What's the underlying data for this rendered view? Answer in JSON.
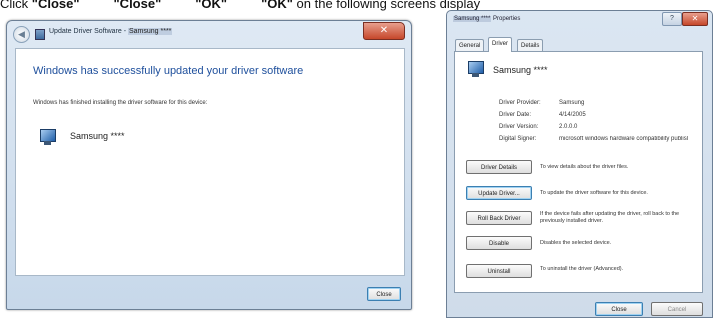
{
  "caption": {
    "prefix": "Click ",
    "word1": "\"Close\"",
    "word2": "\"Close\"",
    "word3": "\"OK\"",
    "word4": "\"OK\"",
    "suffix": "on the following screens display"
  },
  "left_window": {
    "title_prefix": "Update Driver Software - ",
    "title_brand": "Samsung ****",
    "close_glyph": "✕",
    "heading": "Windows has successfully updated your driver software",
    "subtext": "Windows has finished installing the driver software for this device:",
    "device_name": "Samsung ****",
    "close_button": "Close"
  },
  "right_window": {
    "title_brand": "Samsung ****",
    "title_suffix": " Properties",
    "help_glyph": "?",
    "close_glyph": "✕",
    "tabs": [
      {
        "label": "General",
        "active": false
      },
      {
        "label": "Driver",
        "active": true
      },
      {
        "label": "Details",
        "active": false
      }
    ],
    "device_name": "Samsung ****",
    "properties": [
      {
        "label": "Driver Provider:",
        "value": "Samsung"
      },
      {
        "label": "Driver Date:",
        "value": "4/14/2005"
      },
      {
        "label": "Driver Version:",
        "value": "2.0.0.0"
      },
      {
        "label": "Digital Signer:",
        "value": "microsoft windows hardware compatibility publisl"
      }
    ],
    "actions": [
      {
        "button": "Driver Details",
        "description": "To view details about the driver files."
      },
      {
        "button": "Update Driver...",
        "description": "To update the driver software for this device."
      },
      {
        "button": "Roll Back Driver",
        "description": "If the device fails after updating the driver, roll back to the previously installed driver."
      },
      {
        "button": "Disable",
        "description": "Disables the selected device."
      },
      {
        "button": "Uninstall",
        "description": "To uninstall the driver (Advanced)."
      }
    ],
    "footer_close": "Close",
    "footer_cancel": "Cancel"
  }
}
